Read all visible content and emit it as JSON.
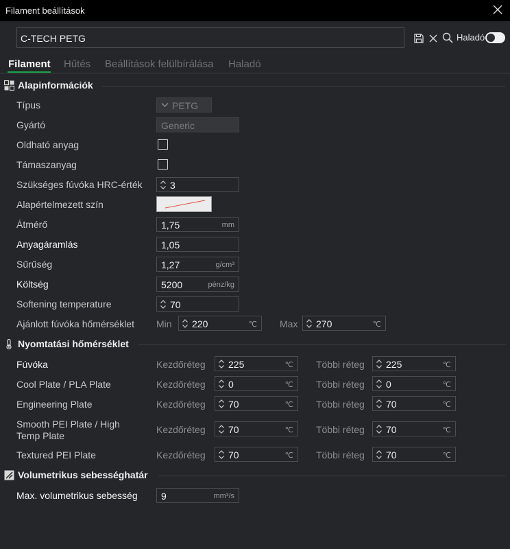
{
  "window": {
    "title": "Filament beállítások"
  },
  "preset": {
    "name": "C-TECH PETG",
    "advanced_label": "Haladó"
  },
  "tabs": [
    {
      "label": "Filament",
      "active": true
    },
    {
      "label": "Hűtés",
      "active": false
    },
    {
      "label": "Beállítások felülbírálása",
      "active": false
    },
    {
      "label": "Haladó",
      "active": false
    }
  ],
  "basic": {
    "title": "Alapinformációk",
    "type_label": "Típus",
    "type_value": "PETG",
    "vendor_label": "Gyártó",
    "vendor_value": "Generic",
    "soluble_label": "Oldható anyag",
    "soluble_checked": false,
    "support_label": "Támaszanyag",
    "support_checked": false,
    "hrc_label": "Szükséges fúvóka HRC-érték",
    "hrc_value": "3",
    "color_label": "Alapértelmezett szín",
    "diameter_label": "Átmérő",
    "diameter_value": "1,75",
    "diameter_unit": "mm",
    "flow_label": "Anyagáramlás",
    "flow_value": "1,05",
    "density_label": "Sűrűség",
    "density_value": "1,27",
    "density_unit": "g/cm³",
    "cost_label": "Költség",
    "cost_value": "5200",
    "cost_unit": "pénz/kg",
    "softening_label": "Softening temperature",
    "softening_value": "70",
    "nozzle_temp_label": "Ajánlott fúvóka hőmérséklet",
    "min_label": "Min",
    "min_value": "220",
    "max_label": "Max",
    "max_value": "270",
    "temp_unit": "℃"
  },
  "print_temp": {
    "title": "Nyomtatási hőmérséklet",
    "first_layer_label": "Kezdőréteg",
    "other_layers_label": "Többi réteg",
    "unit": "℃",
    "rows": [
      {
        "label": "Fúvóka",
        "first": "225",
        "other": "225"
      },
      {
        "label": "Cool Plate / PLA Plate",
        "first": "0",
        "other": "0"
      },
      {
        "label": "Engineering Plate",
        "first": "70",
        "other": "70"
      },
      {
        "label_line1": "Smooth PEI Plate / High",
        "label_line2": "Temp Plate",
        "first": "70",
        "other": "70"
      },
      {
        "label": "Textured PEI Plate",
        "first": "70",
        "other": "70"
      }
    ]
  },
  "volumetric": {
    "title": "Volumetrikus sebességhatár",
    "max_label": "Max. volumetrikus sebesség",
    "max_value": "9",
    "unit": "mm³/s"
  },
  "icons": {
    "save": "save-icon",
    "delete": "close-icon",
    "search": "search-icon",
    "basic": "grid-icon",
    "temp": "thermometer-icon",
    "volumetric": "volume-icon"
  },
  "colors": {
    "accent": "#19a34a",
    "background": "#242629",
    "titlebar": "#000000",
    "filament_color_line": "#e0533f"
  }
}
